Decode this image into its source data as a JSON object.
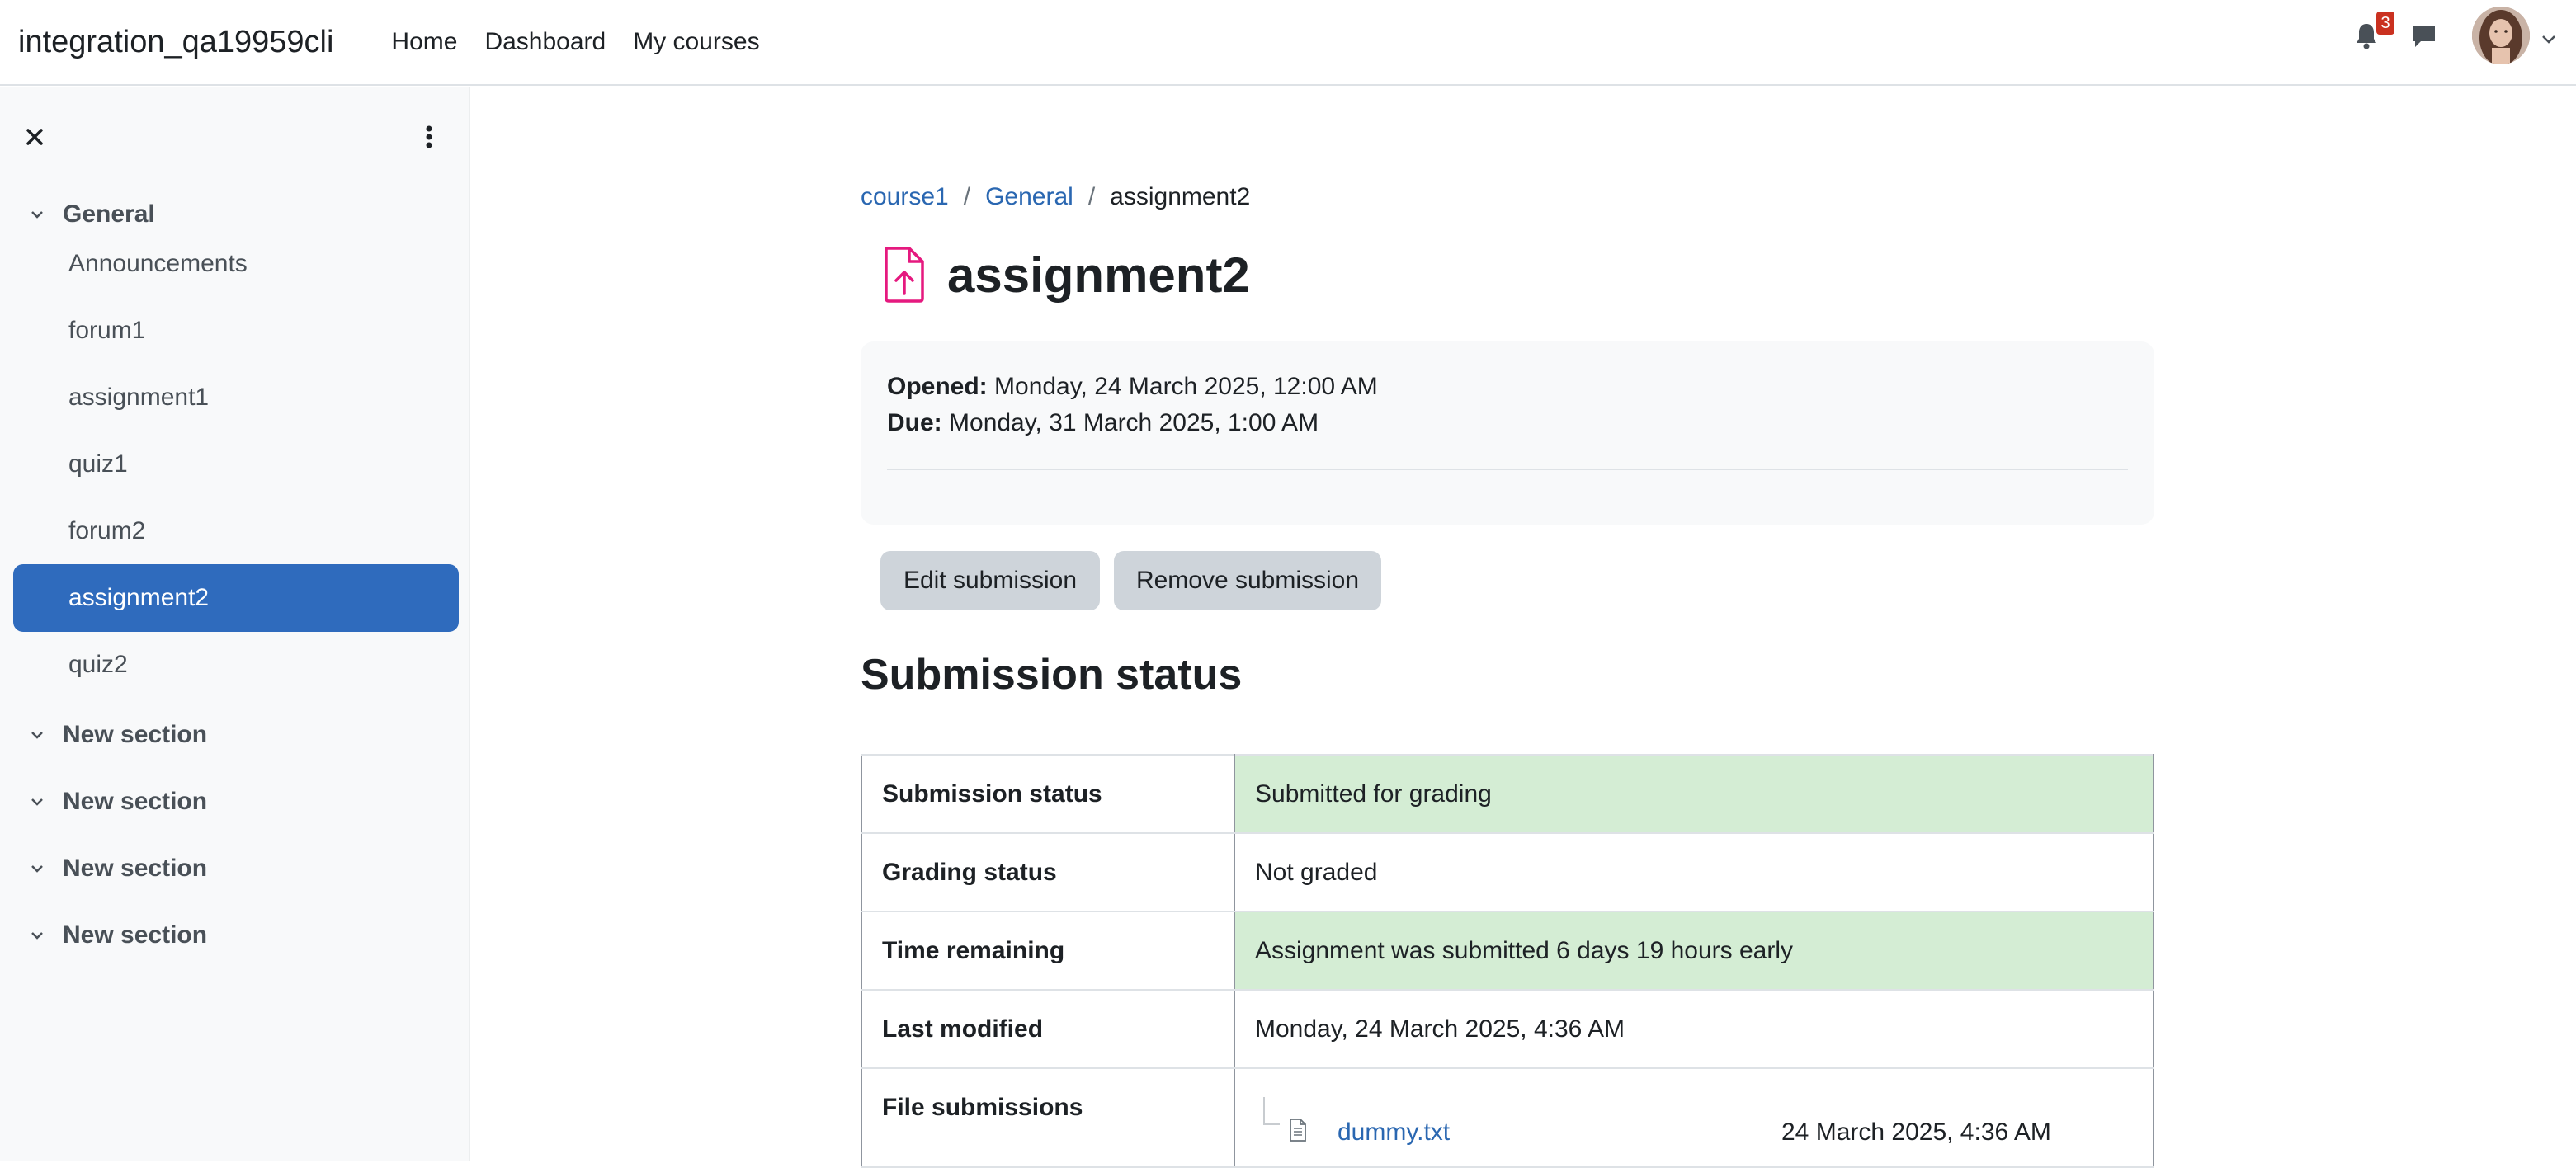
{
  "navbar": {
    "site_name": "integration_qa19959cli",
    "links": [
      "Home",
      "Dashboard",
      "My courses"
    ],
    "notification_count": "3",
    "icons": [
      "bell-icon",
      "chat-icon",
      "chevron-down-icon"
    ]
  },
  "drawer": {
    "sections": [
      {
        "title": "General",
        "activities": [
          "Announcements",
          "forum1",
          "assignment1",
          "quiz1",
          "forum2",
          "assignment2",
          "quiz2"
        ]
      },
      {
        "title": "New section",
        "activities": []
      },
      {
        "title": "New section",
        "activities": []
      },
      {
        "title": "New section",
        "activities": []
      },
      {
        "title": "New section",
        "activities": []
      }
    ],
    "active_activity": "assignment2"
  },
  "breadcrumb": {
    "items": [
      "course1",
      "General",
      "assignment2"
    ],
    "separator": "/"
  },
  "page": {
    "title": "assignment2",
    "icon": "file-upload-icon",
    "accent_color": "#e5197f",
    "dates": {
      "opened_label": "Opened:",
      "opened_value": "Monday, 24 March 2025, 12:00 AM",
      "due_label": "Due:",
      "due_value": "Monday, 31 March 2025, 1:00 AM"
    },
    "buttons": {
      "edit": "Edit submission",
      "remove": "Remove submission"
    }
  },
  "submission": {
    "heading": "Submission status",
    "rows": [
      {
        "label": "Submission status",
        "value": "Submitted for grading",
        "status": "success"
      },
      {
        "label": "Grading status",
        "value": "Not graded",
        "status": ""
      },
      {
        "label": "Time remaining",
        "value": "Assignment was submitted 6 days 19 hours early",
        "status": "success"
      },
      {
        "label": "Last modified",
        "value": "Monday, 24 March 2025, 4:36 AM",
        "status": ""
      }
    ],
    "files_label": "File submissions",
    "files": [
      {
        "name": "dummy.txt",
        "date": "24 March 2025, 4:36 AM"
      }
    ]
  },
  "colors": {
    "primary": "#2f6bbd",
    "link": "#2a67b1",
    "success_bg": "#d4edd4",
    "badge": "#ca3120"
  }
}
